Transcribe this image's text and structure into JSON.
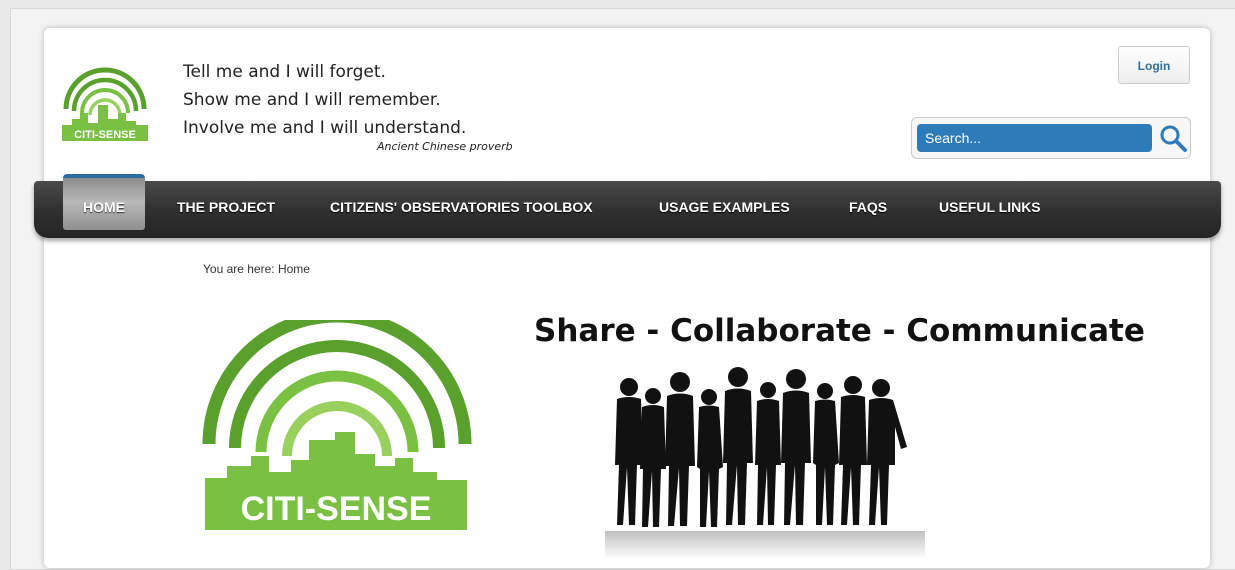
{
  "header": {
    "logo_text": "CITI-SENSE",
    "quote_lines": [
      "Tell me and I will forget.",
      "Show me and I will remember.",
      "Involve me and I will understand."
    ],
    "quote_attribution": "Ancient Chinese proverb",
    "login_label": "Login",
    "search_placeholder": "Search..."
  },
  "nav": {
    "items": [
      {
        "label": "HOME",
        "active": true
      },
      {
        "label": "THE PROJECT"
      },
      {
        "label": "CITIZENS' OBSERVATORIES TOOLBOX"
      },
      {
        "label": "USAGE EXAMPLES"
      },
      {
        "label": "FAQS"
      },
      {
        "label": "USEFUL LINKS"
      }
    ]
  },
  "content": {
    "breadcrumb": "You are here: Home",
    "tagline": "Share - Collaborate - Communicate",
    "logo_text": "CITI-SENSE"
  },
  "colors": {
    "accent_blue": "#2d7bb8",
    "brand_green": "#7ac043",
    "brand_green_dark": "#5aa02c",
    "nav_dark": "#2f2f2f"
  }
}
